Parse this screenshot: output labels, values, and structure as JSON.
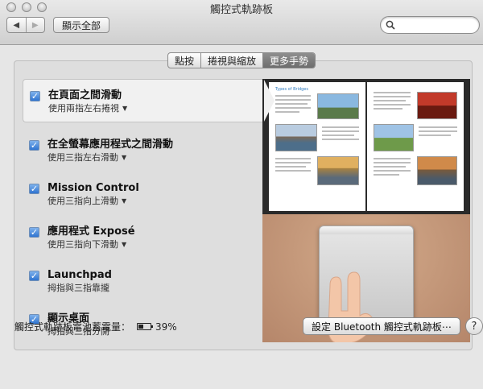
{
  "window": {
    "title": "觸控式軌跡板"
  },
  "toolbar": {
    "back_icon": "◀",
    "forward_icon": "▶",
    "show_all_label": "顯示全部",
    "search": {
      "value": "",
      "placeholder": ""
    }
  },
  "tabs": [
    {
      "label": "點按",
      "active": false
    },
    {
      "label": "捲視與縮放",
      "active": false
    },
    {
      "label": "更多手勢",
      "active": true
    }
  ],
  "gestures": [
    {
      "title": "在頁面之間滑動",
      "subtitle": "使用兩指左右捲視",
      "checked": true,
      "has_dropdown": true,
      "selected": true
    },
    {
      "title": "在全螢幕應用程式之間滑動",
      "subtitle": "使用三指左右滑動",
      "checked": true,
      "has_dropdown": true,
      "selected": false
    },
    {
      "title": "Mission Control",
      "subtitle": "使用三指向上滑動",
      "checked": true,
      "has_dropdown": true,
      "selected": false
    },
    {
      "title": "應用程式 Exposé",
      "subtitle": "使用三指向下滑動",
      "checked": true,
      "has_dropdown": true,
      "selected": false
    },
    {
      "title": "Launchpad",
      "subtitle": "拇指與三指靠攏",
      "checked": true,
      "has_dropdown": false,
      "selected": false
    },
    {
      "title": "顯示桌面",
      "subtitle": "拇指與三指分開",
      "checked": true,
      "has_dropdown": false,
      "selected": false
    }
  ],
  "preview": {
    "book_title": "Types of Bridges"
  },
  "footer": {
    "battery_label": "觸控式軌跡板電池蓄電量：",
    "battery_percent": "39%",
    "battery_level": 0.39,
    "bluetooth_button_label": "設定 Bluetooth 觸控式軌跡板⋯",
    "help_label": "?"
  },
  "colors": {
    "checkbox": "#2f74d0",
    "active_tab": "#7a7a7a",
    "trackpad_surface": "#d6d6d6",
    "table_surface": "#c59a79"
  }
}
